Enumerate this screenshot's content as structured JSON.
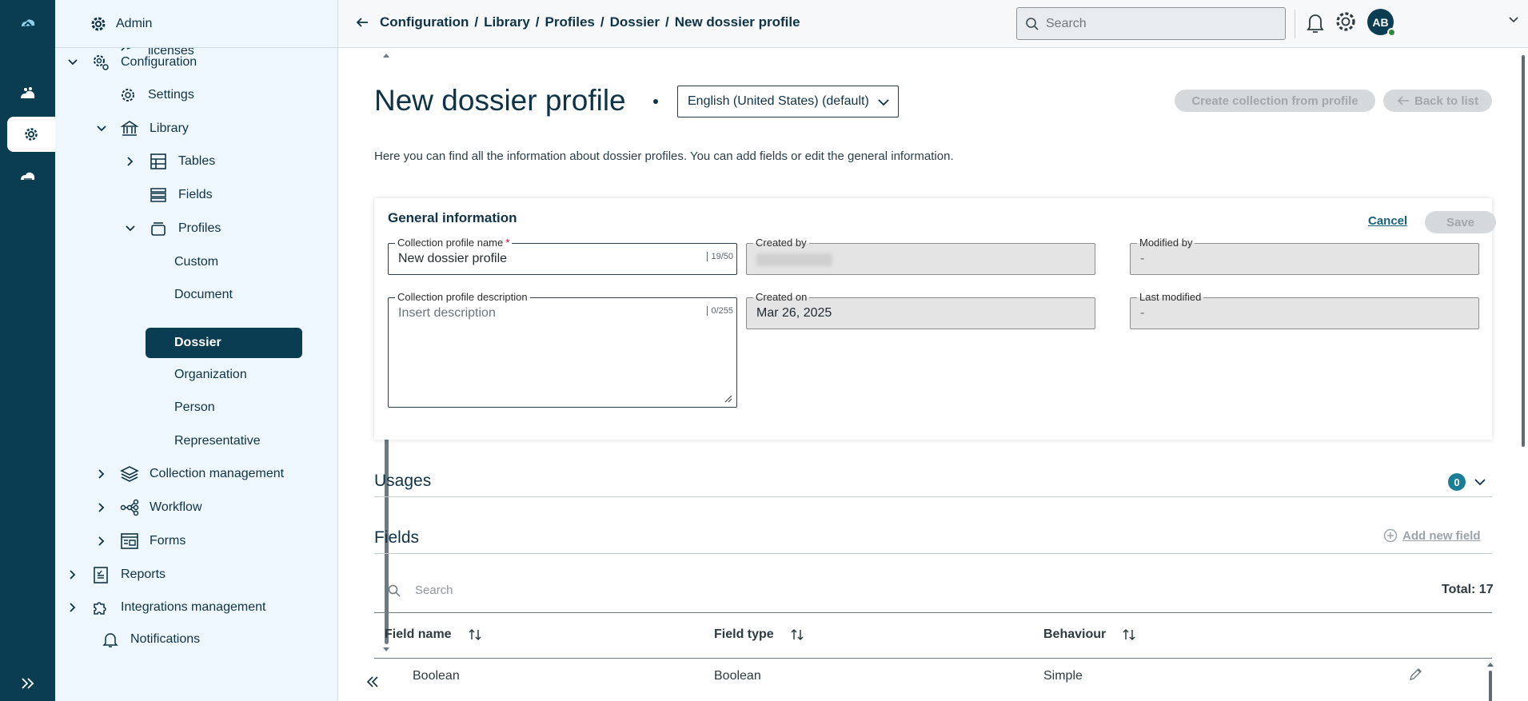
{
  "rail": {
    "items": [
      {
        "icon": "cloud-logo-icon"
      },
      {
        "icon": "cloud-people-icon"
      },
      {
        "icon": "gear-icon",
        "active": true
      },
      {
        "icon": "cloud-hand-icon"
      }
    ],
    "expand_icon": "double-chevron-right-icon"
  },
  "sidebar": {
    "header": "Admin",
    "items": [
      {
        "label": "licenses",
        "icon": "licenses-icon"
      },
      {
        "label": "Configuration",
        "icon": "config-gear-icon",
        "expanded": true
      },
      {
        "label": "Settings",
        "icon": "gear-icon"
      },
      {
        "label": "Library",
        "icon": "library-icon",
        "expanded": true
      },
      {
        "label": "Tables",
        "icon": "table-icon",
        "expanded": false
      },
      {
        "label": "Fields",
        "icon": "fields-icon"
      },
      {
        "label": "Profiles",
        "icon": "profiles-icon",
        "expanded": true
      },
      {
        "label": "Custom"
      },
      {
        "label": "Document"
      },
      {
        "label": "Dossier",
        "selected": true
      },
      {
        "label": "Organization"
      },
      {
        "label": "Person"
      },
      {
        "label": "Representative"
      },
      {
        "label": "Collection management",
        "icon": "layers-icon",
        "expanded": false
      },
      {
        "label": "Workflow",
        "icon": "workflow-icon",
        "expanded": false
      },
      {
        "label": "Forms",
        "icon": "form-icon",
        "expanded": false
      },
      {
        "label": "Reports",
        "icon": "report-icon",
        "expanded": false
      },
      {
        "label": "Integrations management",
        "icon": "puzzle-icon",
        "expanded": false
      },
      {
        "label": "Notifications",
        "icon": "bell-icon"
      }
    ]
  },
  "topbar": {
    "breadcrumb": [
      "Configuration",
      "Library",
      "Profiles",
      "Dossier",
      "New dossier profile"
    ],
    "search_placeholder": "Search",
    "avatar_initials": "AB"
  },
  "page": {
    "title": "New dossier profile",
    "language": "English (United States) (default)",
    "create_collection_label": "Create collection from profile",
    "back_label": "Back to list",
    "intro": "Here you can find all the information about dossier profiles. You can add fields or edit the general information."
  },
  "general": {
    "heading": "General information",
    "cancel_label": "Cancel",
    "save_label": "Save",
    "name_label": "Collection profile name",
    "name_value": "New dossier profile",
    "name_count": "19/50",
    "desc_label": "Collection profile description",
    "desc_placeholder": "Insert description",
    "desc_count": "0/255",
    "created_by_label": "Created by",
    "modified_by_label": "Modified by",
    "modified_by_value": "-",
    "created_on_label": "Created on",
    "created_on_value": "Mar 26, 2025",
    "last_modified_label": "Last modified",
    "last_modified_value": "-"
  },
  "usages": {
    "heading": "Usages",
    "count": "0"
  },
  "fields": {
    "heading": "Fields",
    "add_label": "Add new field",
    "search_placeholder": "Search",
    "total": "Total: 17",
    "columns": [
      "Field name",
      "Field type",
      "Behaviour"
    ],
    "rows": [
      [
        "Boolean",
        "Boolean",
        "Simple"
      ]
    ]
  }
}
